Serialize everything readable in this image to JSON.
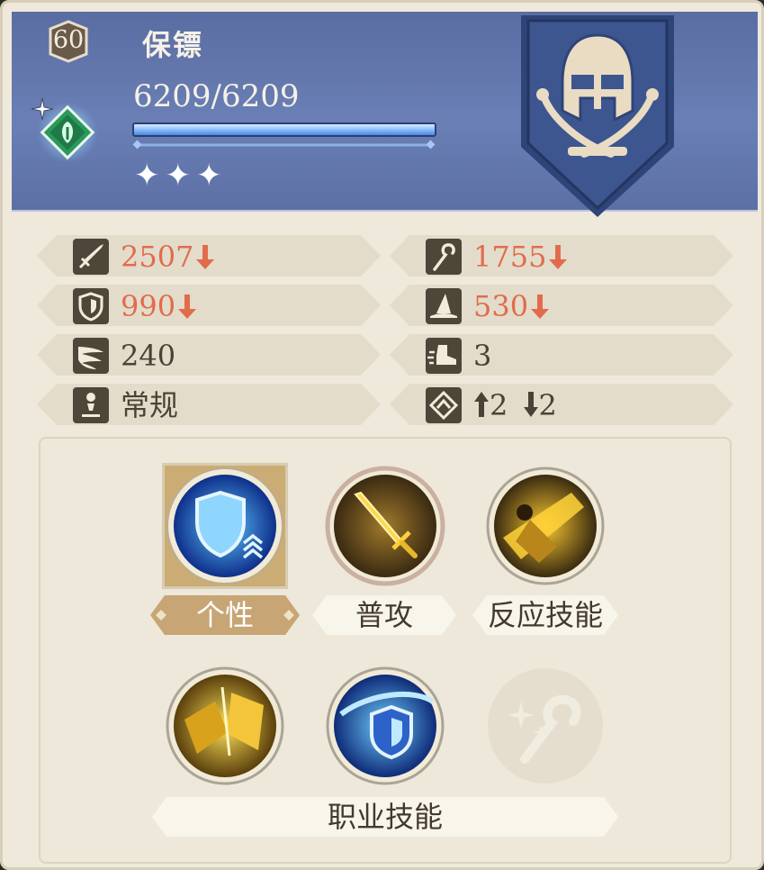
{
  "unit": {
    "level": "60",
    "name": "保镖",
    "hp_text": "6209/6209",
    "hp_fraction": 1.0,
    "stars": "✦✦✦",
    "class_emblem": "helmet-crossed-swords-icon"
  },
  "stats": {
    "attack": {
      "value": "2507",
      "trend": "down",
      "icon": "sword-icon"
    },
    "magic_attack": {
      "value": "1755",
      "trend": "down",
      "icon": "staff-icon"
    },
    "defense": {
      "value": "990",
      "trend": "down",
      "icon": "shield-icon"
    },
    "magic_defense": {
      "value": "530",
      "trend": "down",
      "icon": "wizard-hat-icon"
    },
    "evasion": {
      "value": "240",
      "icon": "wing-icon"
    },
    "move": {
      "value": "3",
      "icon": "boot-icon"
    },
    "type": {
      "value": "常规",
      "icon": "figure-icon"
    },
    "jump": {
      "up": "2",
      "down": "2",
      "icon": "jump-icon"
    }
  },
  "skills": {
    "trait_label": "个性",
    "normal_attack_label": "普攻",
    "reaction_label": "反应技能",
    "class_skills_label": "职业技能"
  },
  "colors": {
    "header": "#6274ad",
    "stat_down": "#e16c4c",
    "panel_bg": "#efe9dc",
    "selected_label": "#c7a574"
  }
}
